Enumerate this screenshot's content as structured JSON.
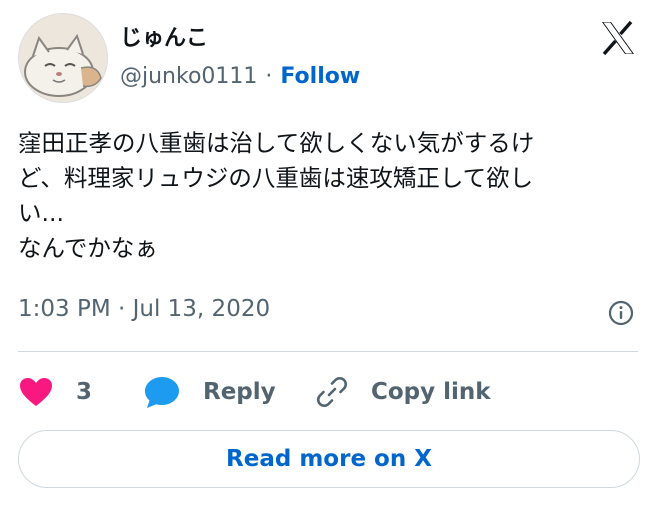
{
  "author": {
    "display_name": "じゅんこ",
    "handle": "@junko0111",
    "separator": "·",
    "follow_label": "Follow"
  },
  "tweet": {
    "lines": [
      "窪田正孝の八重歯は治して欲しくない気がするけ",
      "ど、料理家リュウジの八重歯は速攻矯正して欲し",
      "い...",
      "なんでかなぁ"
    ],
    "timestamp": "1:03 PM · Jul 13, 2020"
  },
  "actions": {
    "like_count": "3",
    "reply_label": "Reply",
    "copy_label": "Copy link"
  },
  "footer": {
    "read_more_label": "Read more on X"
  },
  "colors": {
    "accent": "#0066cc",
    "heart": "#f91880",
    "reply_icon": "#1d9bf0",
    "muted": "#536471"
  },
  "icons": [
    "x-logo-icon",
    "info-icon",
    "heart-icon",
    "reply-bubble-icon",
    "link-icon"
  ]
}
